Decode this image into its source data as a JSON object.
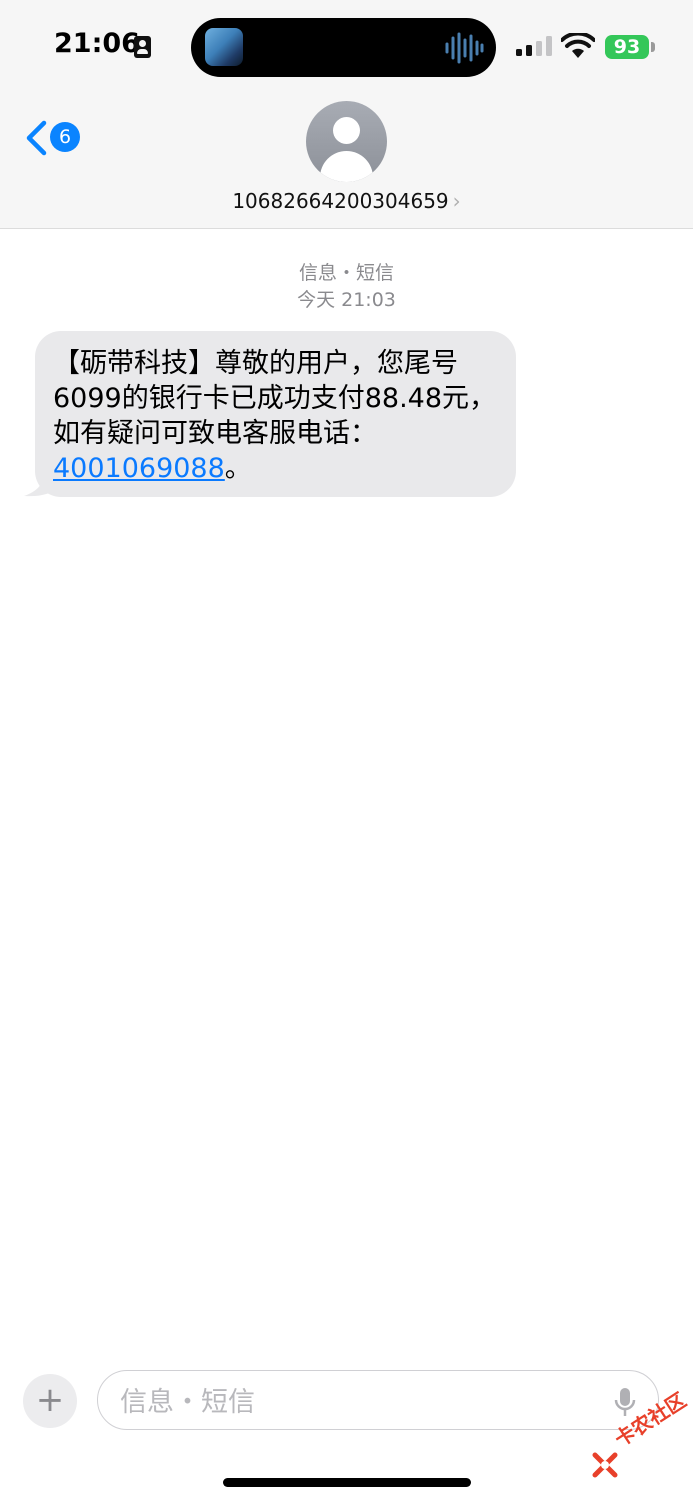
{
  "status_bar": {
    "time": "21:06",
    "battery_level": "93",
    "icons": [
      "contact-card-icon",
      "now-playing-album-art",
      "audio-waveform-icon",
      "cellular-signal-icon",
      "wifi-icon",
      "battery-icon"
    ]
  },
  "header": {
    "back_badge_count": "6",
    "contact_number": "10682664200304659",
    "contact_chevron": "›"
  },
  "thread": {
    "service_label": "信息・短信",
    "timestamp": "今天 21:03",
    "message": {
      "text": "【砺带科技】尊敬的用户，您尾号6099的银行卡已成功支付88.48元，如有疑问可致电客服电话：",
      "phone_link": "4001069088",
      "suffix": "。",
      "bubble_color": "#e9e9eb",
      "link_color": "#0a7aff"
    }
  },
  "compose": {
    "placeholder": "信息・短信",
    "plus_label": "+"
  },
  "watermark": {
    "text": "卡农社区",
    "color": "#e8402a"
  },
  "colors": {
    "accent": "#0a84ff",
    "battery": "#34c759",
    "secondary_text": "#8a8a8e"
  }
}
